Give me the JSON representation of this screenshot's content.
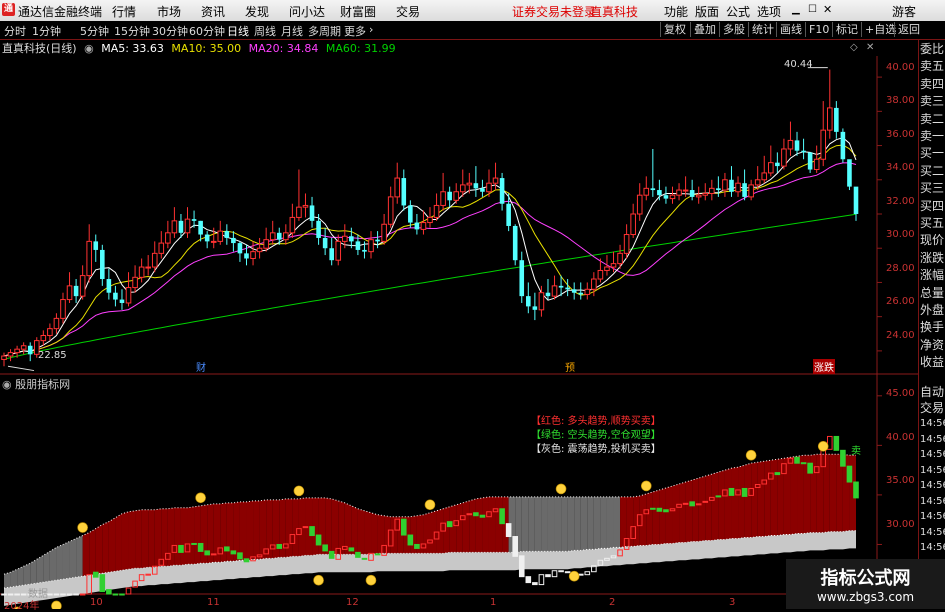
{
  "menubar": {
    "logo": "通",
    "app_name": "通达信金融终端",
    "items": [
      "行情",
      "市场",
      "资讯",
      "发现",
      "问小达",
      "财富圈",
      "交易"
    ],
    "notice": "证券交易未登录",
    "stock": "直真科技",
    "right_items": [
      "功能",
      "版面",
      "公式",
      "选项"
    ],
    "guest": "游客"
  },
  "toolbar": {
    "periods": [
      "分时",
      "1分钟",
      "5分钟",
      "15分钟",
      "30分钟",
      "60分钟",
      "日线",
      "周线",
      "月线",
      "多周期",
      "更多"
    ],
    "active": "日线",
    "right_buttons": [
      "复权",
      "叠加",
      "多股",
      "统计",
      "画线",
      "F10",
      "标记",
      "+自选",
      "返回"
    ]
  },
  "info": {
    "title": "直真科技(日线)",
    "ma5": "MA5: 33.63",
    "ma10": "MA10: 35.00",
    "ma20": "MA20: 34.84",
    "ma60": "MA60: 31.99",
    "colors": {
      "ma5": "#ffffff",
      "ma10": "#e8e000",
      "ma20": "#ff40ff",
      "ma60": "#00d000"
    }
  },
  "sidebar": {
    "upper": [
      "委比",
      "卖五",
      "卖四",
      "卖三",
      "卖二",
      "卖一",
      "买一",
      "买二",
      "买三",
      "买四",
      "买五",
      "现价",
      "涨跌",
      "涨幅",
      "总量",
      "外盘",
      "换手",
      "净资",
      "收益"
    ],
    "lower": [
      "自动",
      "交易",
      "14:56",
      "14:56",
      "14:56",
      "14:56",
      "14:56",
      "14:56",
      "14:56",
      "14:56",
      "14:56"
    ]
  },
  "price_axis": [
    "40.00",
    "38.00",
    "36.00",
    "34.00",
    "32.00",
    "30.00",
    "28.00",
    "26.00",
    "24.00"
  ],
  "price_annotations": {
    "high": "40.44",
    "low": "22.85",
    "marker_cai": "财",
    "marker_yu": "预",
    "marker_zhangdie": "涨跌"
  },
  "indicator": {
    "name": "殷朋指标网",
    "axis": [
      "45.00",
      "40.00",
      "35.00",
      "30.00"
    ],
    "legend": [
      {
        "text": "【红色: 多头趋势,顺势买卖】",
        "color": "#ff3030"
      },
      {
        "text": "【绿色: 空头趋势,空仓观望】",
        "color": "#30e030"
      },
      {
        "text": "【灰色: 震荡趋势,投机买卖】",
        "color": "#e8e8e8"
      }
    ],
    "sell_mark": "卖",
    "data_label": "数据"
  },
  "time_axis": [
    "2024年",
    "10",
    "11",
    "12",
    "1",
    "2",
    "3"
  ],
  "watermark": {
    "title": "指标公式网",
    "url": "www.zbgs3.com"
  },
  "chart_data": {
    "type": "candlestick",
    "ylim": [
      23.0,
      41.0
    ],
    "open": [
      23.5,
      23.7,
      23.9,
      24.1,
      24.3,
      23.8,
      24.6,
      24.9,
      25.3,
      25.9,
      27.0,
      27.8,
      27.2,
      28.4,
      30.4,
      29.9,
      28.2,
      27.4,
      27.0,
      26.8,
      27.7,
      28.3,
      28.9,
      28.9,
      29.7,
      30.3,
      30.9,
      31.6,
      30.9,
      31.7,
      31.6,
      30.8,
      30.4,
      30.4,
      31.0,
      30.6,
      30.3,
      29.7,
      29.4,
      29.8,
      30.0,
      30.5,
      30.9,
      30.5,
      30.9,
      31.8,
      32.4,
      32.5,
      31.6,
      30.6,
      30.0,
      29.3,
      30.4,
      30.7,
      30.4,
      29.9,
      29.8,
      30.5,
      30.4,
      31.4,
      33.0,
      34.1,
      32.5,
      31.5,
      31.1,
      31.5,
      31.8,
      32.5,
      33.3,
      32.8,
      33.3,
      33.7,
      33.8,
      33.5,
      33.3,
      33.8,
      34.1,
      32.6,
      31.3,
      29.3,
      27.2,
      26.6,
      26.4,
      27.4,
      27.2,
      27.8,
      27.7,
      27.6,
      27.4,
      27.3,
      27.6,
      28.2,
      28.7,
      28.9,
      29.1,
      29.7,
      30.8,
      32.0,
      33.1,
      33.5,
      33.4,
      33.1,
      32.9,
      33.1,
      33.4,
      33.4,
      33.0,
      33.1,
      33.2,
      33.5,
      33.4,
      34.0,
      33.3,
      33.8,
      33.0,
      33.7,
      34.0,
      34.4,
      35.0,
      34.8,
      35.8,
      36.3,
      35.7,
      35.6,
      34.6,
      35.2,
      36.9,
      38.2,
      36.8,
      35.2,
      33.6
    ],
    "close": [
      23.7,
      23.9,
      24.1,
      24.3,
      23.8,
      24.6,
      24.9,
      25.3,
      25.9,
      27.0,
      27.8,
      27.2,
      28.4,
      30.4,
      29.9,
      28.2,
      27.4,
      27.0,
      26.8,
      27.7,
      28.3,
      28.9,
      28.9,
      29.7,
      30.3,
      30.9,
      31.6,
      30.9,
      31.7,
      31.6,
      30.8,
      30.4,
      30.4,
      31.0,
      30.6,
      30.3,
      29.7,
      29.4,
      29.8,
      30.0,
      30.5,
      30.9,
      30.5,
      30.9,
      31.8,
      32.4,
      32.5,
      31.6,
      30.6,
      30.0,
      29.3,
      30.4,
      30.7,
      30.4,
      29.9,
      29.8,
      30.5,
      30.4,
      31.4,
      33.0,
      34.1,
      32.5,
      31.5,
      31.1,
      31.5,
      31.8,
      32.5,
      33.3,
      32.8,
      33.3,
      33.7,
      33.8,
      33.5,
      33.3,
      33.8,
      34.1,
      32.6,
      31.3,
      29.3,
      27.2,
      26.6,
      26.4,
      27.4,
      27.2,
      27.8,
      27.7,
      27.6,
      27.4,
      27.3,
      27.6,
      28.2,
      28.7,
      28.9,
      29.1,
      29.7,
      30.8,
      32.0,
      33.1,
      33.5,
      33.4,
      33.1,
      32.9,
      33.1,
      33.4,
      33.4,
      33.0,
      33.1,
      33.2,
      33.5,
      33.4,
      34.0,
      33.3,
      33.8,
      33.0,
      33.7,
      34.0,
      34.4,
      35.0,
      34.8,
      35.8,
      36.3,
      35.7,
      35.6,
      34.6,
      35.2,
      36.9,
      38.2,
      36.8,
      35.2,
      33.6,
      32.0
    ],
    "high": [
      23.9,
      24.1,
      24.3,
      24.5,
      24.5,
      24.8,
      25.2,
      25.6,
      26.2,
      27.4,
      28.6,
      28.2,
      29.0,
      31.4,
      30.8,
      30.2,
      28.8,
      27.8,
      27.6,
      28.6,
      29.0,
      29.4,
      29.6,
      30.4,
      31.0,
      31.6,
      32.4,
      32.0,
      32.4,
      32.2,
      31.6,
      31.0,
      31.2,
      31.6,
      31.4,
      31.0,
      30.4,
      30.2,
      30.4,
      30.6,
      31.2,
      31.6,
      31.2,
      31.4,
      32.6,
      34.6,
      33.2,
      33.0,
      32.0,
      31.2,
      30.6,
      30.8,
      31.4,
      31.2,
      30.8,
      30.4,
      31.0,
      31.0,
      32.0,
      33.6,
      35.0,
      34.6,
      32.8,
      32.0,
      32.2,
      32.4,
      33.2,
      34.4,
      33.6,
      33.8,
      34.6,
      34.4,
      34.8,
      34.0,
      34.6,
      35.0,
      34.4,
      33.2,
      31.4,
      29.8,
      28.0,
      27.4,
      27.8,
      28.2,
      28.4,
      28.4,
      28.2,
      28.0,
      28.0,
      28.0,
      28.6,
      29.4,
      29.6,
      29.8,
      30.2,
      31.4,
      32.6,
      33.8,
      34.2,
      35.8,
      34.0,
      33.6,
      33.6,
      33.8,
      34.2,
      34.0,
      33.6,
      33.8,
      34.0,
      34.2,
      34.4,
      34.8,
      34.2,
      34.6,
      34.0,
      34.8,
      35.4,
      36.0,
      35.6,
      36.4,
      37.4,
      36.8,
      36.4,
      35.6,
      36.0,
      38.6,
      40.44,
      38.6,
      37.0,
      34.8,
      33.0
    ],
    "low": [
      23.1,
      23.4,
      23.6,
      23.8,
      23.4,
      23.6,
      24.3,
      24.6,
      25.0,
      25.6,
      26.8,
      26.8,
      27.0,
      28.0,
      29.2,
      27.8,
      27.0,
      26.6,
      26.4,
      26.6,
      27.4,
      28.0,
      28.4,
      28.6,
      29.4,
      30.0,
      30.6,
      30.6,
      30.6,
      31.2,
      30.4,
      30.0,
      30.0,
      30.2,
      30.2,
      29.8,
      29.2,
      29.0,
      29.0,
      29.4,
      29.8,
      30.2,
      30.2,
      30.2,
      30.6,
      31.6,
      31.8,
      31.2,
      30.2,
      29.6,
      29.0,
      29.0,
      30.0,
      30.0,
      29.6,
      29.4,
      29.4,
      30.0,
      30.2,
      31.2,
      32.6,
      32.2,
      31.2,
      30.8,
      30.8,
      31.2,
      31.6,
      32.2,
      32.4,
      32.6,
      33.0,
      33.2,
      33.0,
      33.0,
      33.0,
      33.4,
      32.2,
      31.0,
      29.0,
      26.8,
      26.2,
      25.8,
      26.0,
      27.0,
      27.0,
      27.2,
      27.2,
      27.0,
      27.0,
      27.0,
      27.2,
      28.0,
      28.4,
      28.6,
      28.8,
      29.4,
      30.6,
      31.6,
      32.8,
      33.0,
      32.8,
      32.6,
      32.6,
      32.8,
      33.0,
      32.8,
      32.6,
      32.8,
      32.8,
      33.0,
      33.0,
      33.0,
      33.0,
      32.8,
      32.8,
      33.4,
      33.8,
      34.2,
      34.4,
      34.6,
      35.4,
      35.4,
      35.2,
      34.4,
      34.4,
      34.8,
      36.4,
      36.4,
      35.0,
      33.4,
      31.6
    ],
    "ma60_end": 31.99,
    "indicator_ylim": [
      25.0,
      47.0
    ],
    "indicator_upper": [
      27.0,
      27.2,
      27.5,
      27.8,
      28.1,
      28.5,
      28.9,
      29.3,
      29.7,
      30.0,
      30.3,
      30.6,
      30.9,
      31.2,
      31.6,
      32.0,
      32.3,
      32.7,
      33.1,
      33.3,
      33.4,
      33.5,
      33.5,
      33.5,
      33.6,
      33.6,
      33.7,
      33.7,
      33.7,
      33.8,
      33.9,
      34.0,
      34.1,
      34.1,
      34.2,
      34.2,
      34.3,
      34.3,
      34.4,
      34.4,
      34.5,
      34.5,
      34.5,
      34.6,
      34.6,
      34.6,
      34.7,
      34.7,
      34.7,
      34.7,
      34.6,
      34.4,
      34.2,
      33.9,
      33.6,
      33.4,
      33.2,
      33.0,
      32.9,
      32.8,
      32.8,
      32.8,
      32.8,
      32.9,
      33.0,
      33.2,
      33.4,
      33.6,
      33.8,
      34.0,
      34.2,
      34.4,
      34.6,
      34.7,
      34.8,
      34.8,
      34.8,
      34.8,
      34.8,
      34.8,
      34.8,
      34.8,
      34.8,
      34.8,
      34.8,
      34.8,
      34.8,
      34.8,
      34.8,
      34.8,
      34.8,
      34.8,
      34.8,
      34.8,
      34.8,
      34.8,
      34.8,
      34.9,
      35.1,
      35.3,
      35.5,
      35.7,
      35.9,
      36.1,
      36.3,
      36.5,
      36.7,
      36.9,
      37.1,
      37.3,
      37.5,
      37.7,
      37.8,
      38.0,
      38.2,
      38.3,
      38.4,
      38.5,
      38.6,
      38.7,
      38.8,
      38.9,
      39.0,
      39.0,
      39.1,
      39.1,
      39.1,
      39.1,
      39.1,
      39.0,
      39.0
    ],
    "indicator_lower": [
      25.6,
      25.7,
      25.8,
      25.9,
      26.0,
      26.1,
      26.2,
      26.3,
      26.4,
      26.5,
      26.6,
      26.7,
      26.8,
      26.9,
      27.0,
      27.1,
      27.2,
      27.3,
      27.4,
      27.5,
      27.6,
      27.6,
      27.7,
      27.7,
      27.8,
      27.8,
      27.9,
      27.9,
      28.0,
      28.0,
      28.1,
      28.1,
      28.2,
      28.2,
      28.3,
      28.3,
      28.4,
      28.4,
      28.5,
      28.5,
      28.6,
      28.6,
      28.7,
      28.7,
      28.8,
      28.8,
      28.9,
      28.9,
      29.0,
      29.0,
      29.0,
      29.0,
      29.0,
      29.0,
      29.0,
      29.0,
      29.0,
      29.1,
      29.1,
      29.1,
      29.1,
      29.1,
      29.1,
      29.1,
      29.1,
      29.1,
      29.1,
      29.1,
      29.2,
      29.2,
      29.2,
      29.2,
      29.2,
      29.2,
      29.2,
      29.2,
      29.2,
      29.2,
      29.2,
      29.3,
      29.3,
      29.3,
      29.3,
      29.3,
      29.3,
      29.3,
      29.3,
      29.4,
      29.4,
      29.5,
      29.5,
      29.6,
      29.6,
      29.7,
      29.7,
      29.8,
      29.8,
      29.9,
      29.9,
      30.0,
      30.0,
      30.1,
      30.1,
      30.2,
      30.2,
      30.3,
      30.3,
      30.4,
      30.4,
      30.5,
      30.5,
      30.6,
      30.6,
      30.7,
      30.7,
      30.8,
      30.8,
      30.9,
      30.9,
      31.0,
      31.0,
      31.1,
      31.1,
      31.2,
      31.2,
      31.2,
      31.3,
      31.3,
      31.3,
      31.4,
      31.4
    ],
    "indicator_state": [
      "gray",
      "gray",
      "gray",
      "gray",
      "gray",
      "gray",
      "gray",
      "gray",
      "gray",
      "gray",
      "gray",
      "gray",
      "red",
      "red",
      "red",
      "red",
      "red",
      "red",
      "red",
      "red",
      "red",
      "red",
      "red",
      "red",
      "red",
      "red",
      "red",
      "red",
      "red",
      "red",
      "red",
      "red",
      "red",
      "red",
      "red",
      "red",
      "red",
      "red",
      "red",
      "red",
      "red",
      "red",
      "red",
      "red",
      "red",
      "red",
      "red",
      "red",
      "red",
      "red",
      "red",
      "red",
      "red",
      "red",
      "red",
      "red",
      "red",
      "red",
      "red",
      "red",
      "red",
      "red",
      "red",
      "red",
      "red",
      "red",
      "red",
      "red",
      "red",
      "red",
      "red",
      "red",
      "red",
      "red",
      "red",
      "red",
      "red",
      "gray",
      "gray",
      "gray",
      "gray",
      "gray",
      "gray",
      "gray",
      "gray",
      "gray",
      "gray",
      "gray",
      "gray",
      "gray",
      "gray",
      "gray",
      "gray",
      "gray",
      "red",
      "red",
      "red",
      "red",
      "red",
      "red",
      "red",
      "red",
      "red",
      "red",
      "red",
      "red",
      "red",
      "red",
      "red",
      "red",
      "red",
      "red",
      "red",
      "red",
      "red",
      "red",
      "red",
      "red",
      "red",
      "red",
      "red",
      "red",
      "red",
      "red",
      "red",
      "red",
      "red",
      "red",
      "red",
      "red",
      "red",
      "red",
      "red"
    ]
  }
}
